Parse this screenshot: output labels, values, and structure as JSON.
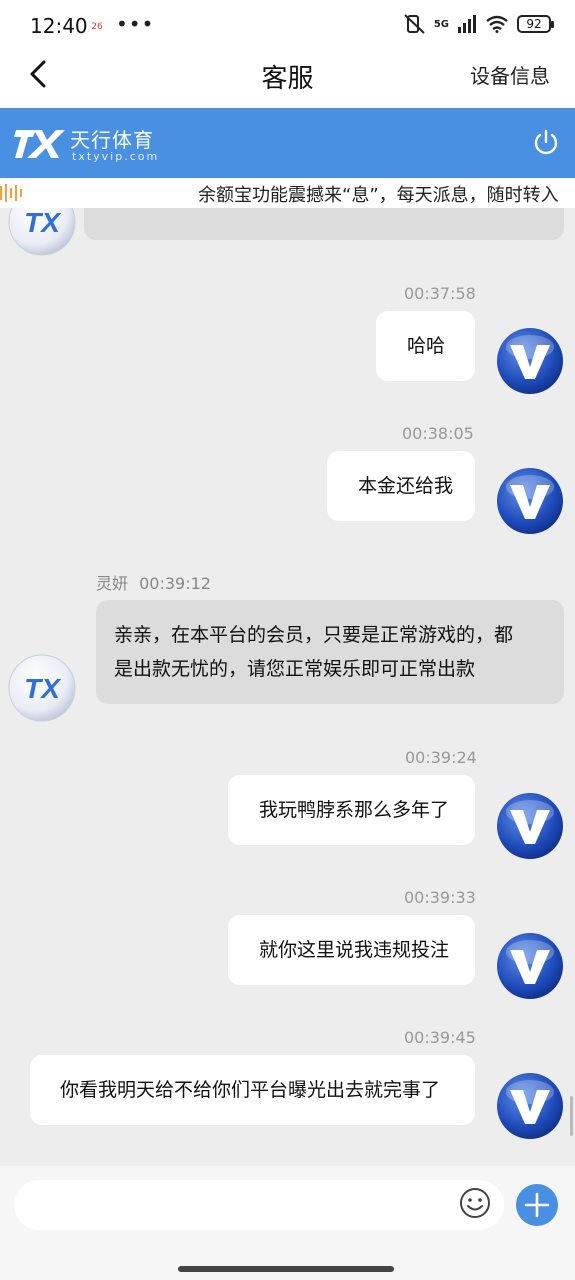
{
  "status": {
    "time": "12:40",
    "notif_badge": "26",
    "more": "•••",
    "network": "5G",
    "battery": "92"
  },
  "header": {
    "title": "客服",
    "right_action": "设备信息"
  },
  "brand": {
    "name": "天行体育",
    "url": "txtyvip.com",
    "color": "#4a90e2"
  },
  "marquee": {
    "text": "余额宝功能震撼来“息”，每天派息，随时转入"
  },
  "messages": [
    {
      "side": "me",
      "time": "00:37:58",
      "text": "哈哈"
    },
    {
      "side": "me",
      "time": "00:38:05",
      "text": "本金还给我"
    },
    {
      "side": "them",
      "sender": "灵妍",
      "time": "00:39:12",
      "lines": [
        "亲亲，在本平台的会员，只要是正常游戏的，都",
        "是出款无忧的，请您正常娱乐即可正常出款"
      ]
    },
    {
      "side": "me",
      "time": "00:39:24",
      "text": "我玩鸭脖系那么多年了"
    },
    {
      "side": "me",
      "time": "00:39:33",
      "text": "就你这里说我违规投注"
    },
    {
      "side": "me",
      "time": "00:39:45",
      "text": "你看我明天给不给你们平台曝光出去就完事了"
    }
  ],
  "input": {
    "placeholder": ""
  },
  "colors": {
    "accent": "#4a90e2",
    "me_bubble": "#ffffff",
    "them_bubble": "#dcdcdc"
  }
}
